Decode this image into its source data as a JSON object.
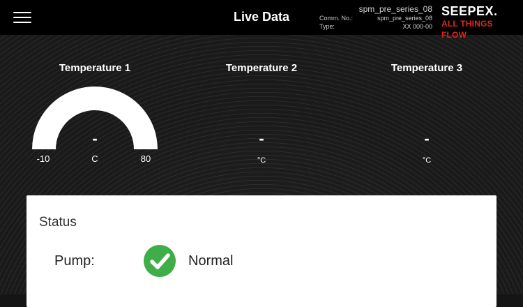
{
  "header": {
    "title": "Live Data",
    "device_name": "spm_pre_series_08",
    "comm_label": "Comm. No.:",
    "comm_value": "spm_pre_series_08",
    "type_label": "Type:",
    "type_value": "XX 000-00",
    "brand_logo": "SEEPEX.",
    "brand_tagline": "ALL THINGS FLOW"
  },
  "gauges": [
    {
      "title": "Temperature 1",
      "value": "-",
      "unit": "C",
      "min": "-10",
      "max": "80"
    },
    {
      "title": "Temperature 2",
      "value": "-",
      "unit": "°C"
    },
    {
      "title": "Temperature 3",
      "value": "-",
      "unit": "°C"
    }
  ],
  "status": {
    "heading": "Status",
    "pump_label": "Pump:",
    "pump_value": "Normal",
    "pump_icon": "check-circle-icon",
    "ok_color": "#3fae49"
  },
  "colors": {
    "header_bg": "#000000",
    "accent_red": "#e4251b"
  }
}
